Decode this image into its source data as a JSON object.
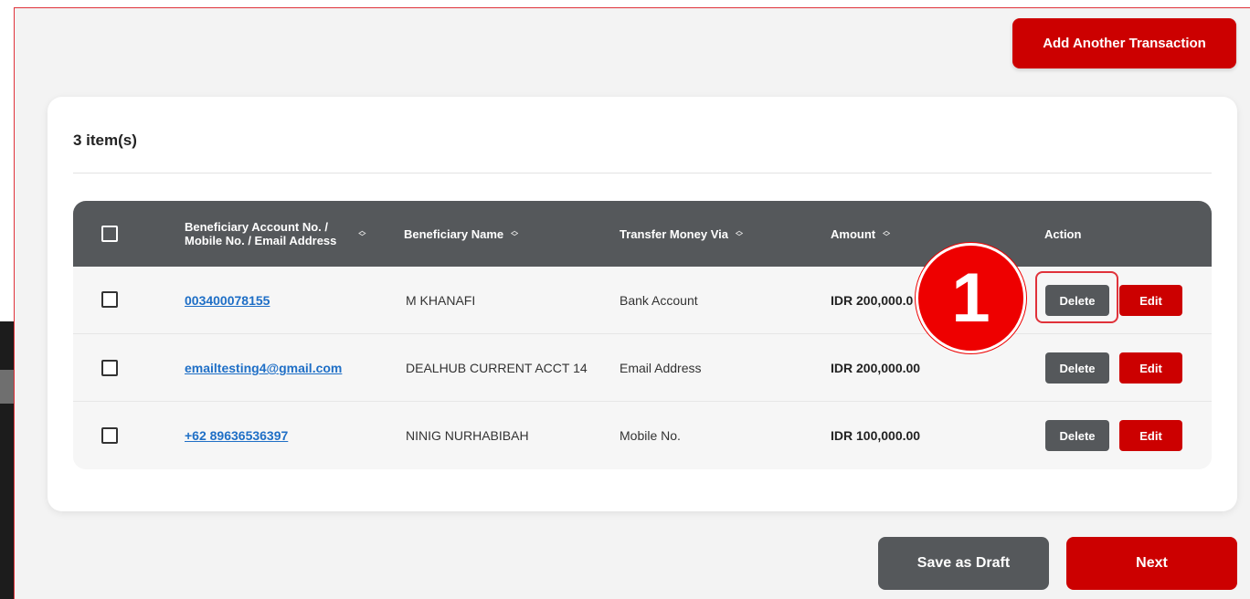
{
  "header": {
    "add_button": "Add Another Transaction"
  },
  "list": {
    "count": "3 item(s)",
    "columns": {
      "account": [
        "Beneficiary Account No. /",
        "Mobile No. / Email Address"
      ],
      "name": "Beneficiary Name",
      "via": "Transfer Money Via",
      "amount": "Amount",
      "action": "Action"
    },
    "rows": [
      {
        "account": "003400078155",
        "name": "M KHANAFI",
        "via": "Bank Account",
        "amount": "IDR 200,000.0",
        "delete": "Delete",
        "edit": "Edit"
      },
      {
        "account": "emailtesting4@gmail.com",
        "name": "DEALHUB CURRENT ACCT 14",
        "via": "Email Address",
        "amount": "IDR 200,000.00",
        "delete": "Delete",
        "edit": "Edit"
      },
      {
        "account": "+62 89636536397",
        "name": "NINIG NURHABIBAH",
        "via": "Mobile No.",
        "amount": "IDR 100,000.00",
        "delete": "Delete",
        "edit": "Edit"
      }
    ]
  },
  "annotation": {
    "step_number": "1"
  },
  "footer": {
    "draft_button": "Save as Draft",
    "next_button": "Next"
  },
  "colors": {
    "brand_red": "#cc0000",
    "header_grey": "#55585b",
    "link_blue": "#1f6fc6",
    "badge_red": "#ee0000"
  },
  "icons": {
    "sort": "sort-updown-icon",
    "checkbox": "checkbox-icon"
  }
}
